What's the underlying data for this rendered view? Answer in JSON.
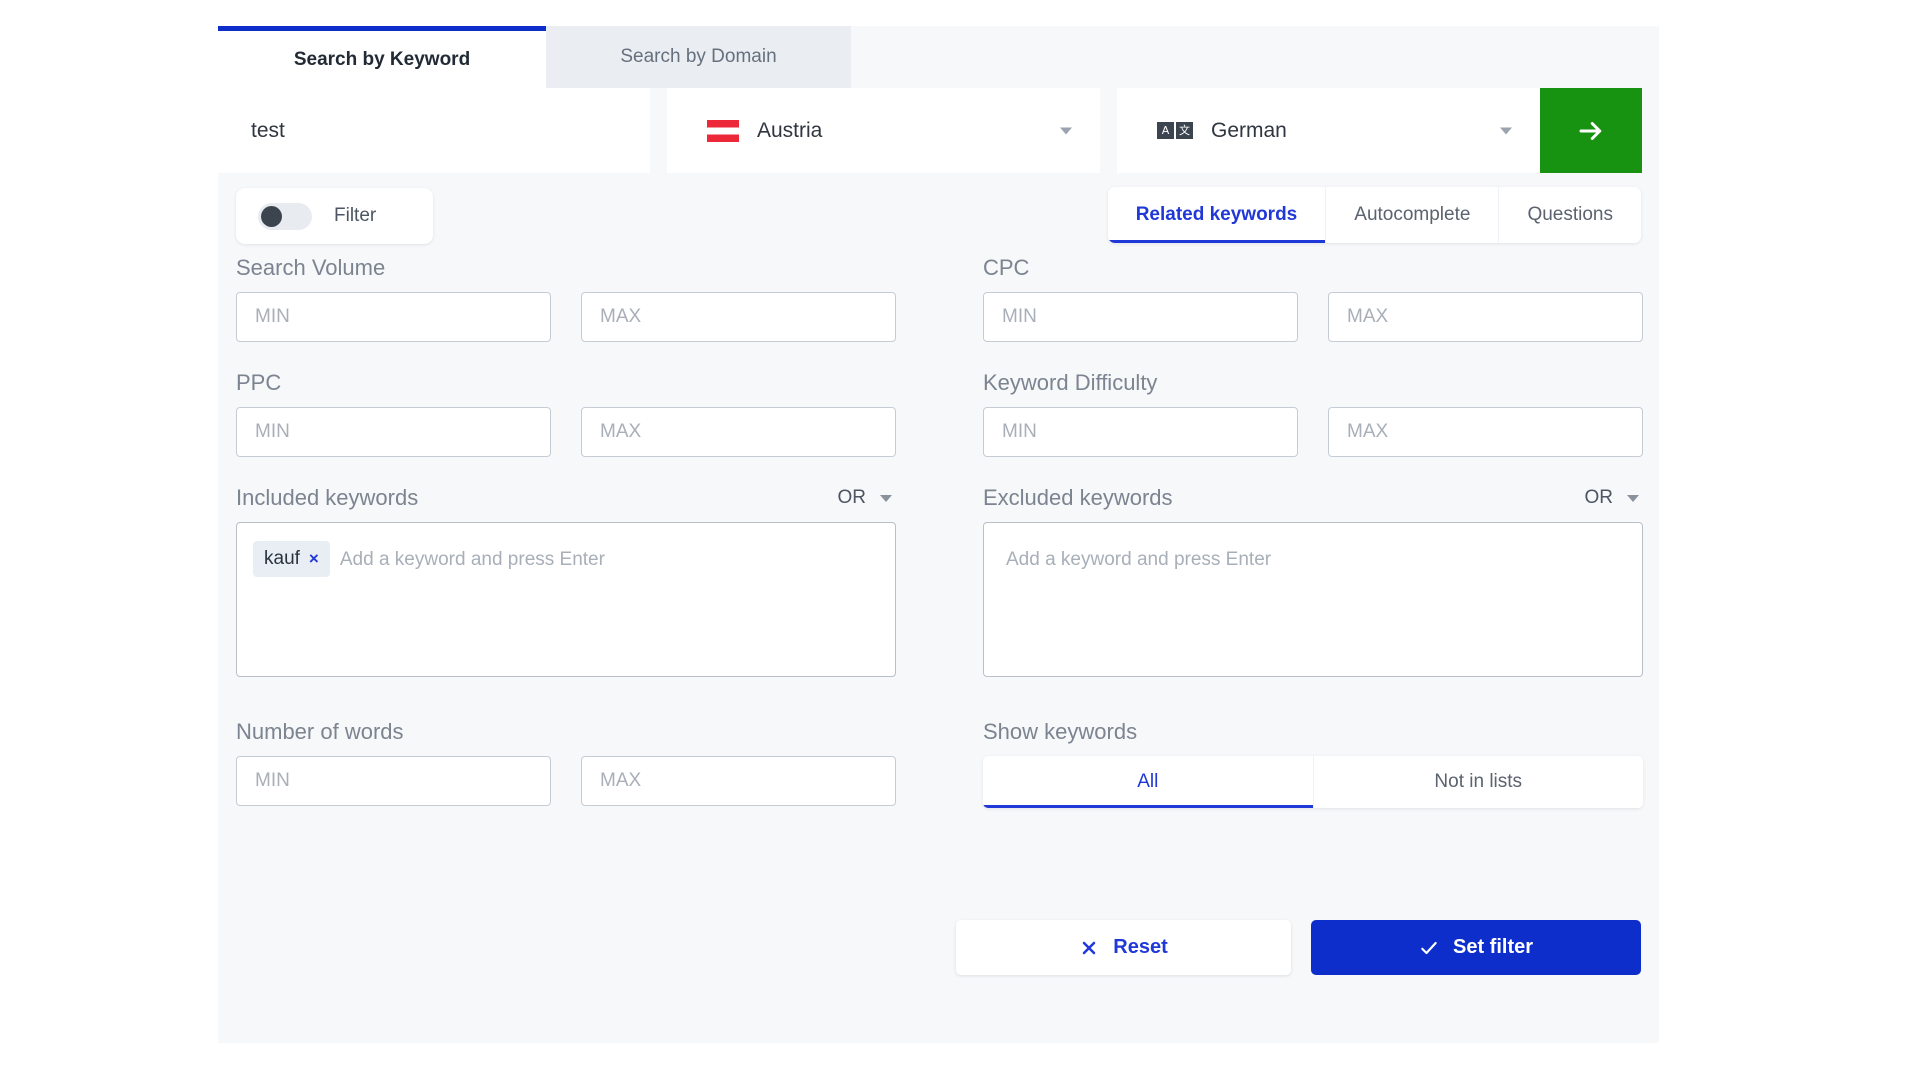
{
  "tabs": {
    "keyword": "Search by Keyword",
    "domain": "Search by Domain"
  },
  "search": {
    "keyword_value": "test",
    "country": "Austria",
    "country_flag_icon": "flag-austria-icon",
    "language": "German",
    "language_icon": "translate-icon",
    "submit_icon": "arrow-right-icon"
  },
  "filter": {
    "toggle_label": "Filter",
    "toggle_state": "off"
  },
  "result_tabs": [
    {
      "label": "Related keywords",
      "active": true
    },
    {
      "label": "Autocomplete",
      "active": false
    },
    {
      "label": "Questions",
      "active": false
    }
  ],
  "fields": {
    "search_volume": {
      "label": "Search Volume",
      "min_placeholder": "MIN",
      "max_placeholder": "MAX",
      "min_value": "",
      "max_value": ""
    },
    "cpc": {
      "label": "CPC",
      "min_placeholder": "MIN",
      "max_placeholder": "MAX",
      "min_value": "",
      "max_value": ""
    },
    "ppc": {
      "label": "PPC",
      "min_placeholder": "MIN",
      "max_placeholder": "MAX",
      "min_value": "",
      "max_value": ""
    },
    "keyword_difficulty": {
      "label": "Keyword Difficulty",
      "min_placeholder": "MIN",
      "max_placeholder": "MAX",
      "min_value": "",
      "max_value": ""
    },
    "number_of_words": {
      "label": "Number of words",
      "min_placeholder": "MIN",
      "max_placeholder": "MAX",
      "min_value": "",
      "max_value": ""
    }
  },
  "included_keywords": {
    "label": "Included keywords",
    "operator": "OR",
    "placeholder": "Add a keyword and press Enter",
    "chips": [
      {
        "text": "kauf",
        "remove_icon": "close-icon"
      }
    ]
  },
  "excluded_keywords": {
    "label": "Excluded keywords",
    "operator": "OR",
    "placeholder": "Add a keyword and press Enter",
    "chips": []
  },
  "show_keywords": {
    "label": "Show keywords",
    "options": [
      {
        "label": "All",
        "active": true
      },
      {
        "label": "Not in lists",
        "active": false
      }
    ]
  },
  "actions": {
    "reset": {
      "label": "Reset",
      "icon": "close-icon"
    },
    "set_filter": {
      "label": "Set filter",
      "icon": "check-icon"
    }
  },
  "colors": {
    "accent_blue": "#0d2ecb",
    "link_blue": "#2138d8",
    "go_green": "#189211",
    "panel_bg": "#f7f8fa",
    "flag_red": "#ed2939"
  }
}
